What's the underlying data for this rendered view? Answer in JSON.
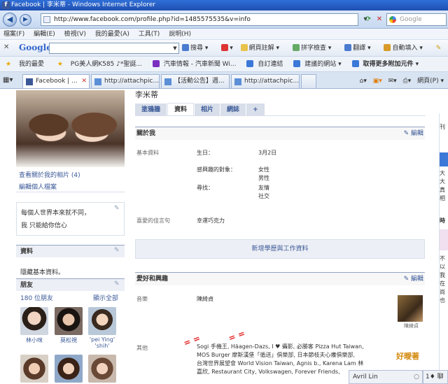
{
  "window": {
    "title": "Facebook | 李米蒂 - Windows Internet Explorer"
  },
  "address_bar": {
    "url": "http://www.facebook.com/profile.php?id=1485575535&v=info",
    "search_placeholder": "Google"
  },
  "menu": [
    "檔案(F)",
    "編輯(E)",
    "檢視(V)",
    "我的最愛(A)",
    "工具(T)",
    "說明(H)"
  ],
  "google_toolbar": {
    "logo": "Google",
    "items": [
      "搜尋 ▾",
      "",
      "網頁註解 ▾",
      "拼字檢查 ▾",
      "翻譯 ▾",
      "自動填入 ▾"
    ]
  },
  "favorites_bar": {
    "label": "我的最愛",
    "items": [
      "PG美人網K585 ♪*聖誕...",
      "汽車情報 - 汽車新聞 Wi...",
      "自訂連結",
      "建議的網站 ▾",
      "取得更多附加元件 ▾"
    ]
  },
  "tabs": [
    {
      "label": "Facebook | ..."
    },
    {
      "label": "http://attachpic..."
    },
    {
      "label": "【活動公告】週..."
    },
    {
      "label": "http://attachpic..."
    }
  ],
  "tab_tools": [
    "網頁(P) ▾"
  ],
  "profile": {
    "name": "李米蒂",
    "tabs": [
      "塗鴉牆",
      "資料",
      "相片",
      "網誌",
      "+"
    ],
    "view_photos": "查看關於我的相片 (4)",
    "edit_profile": "編輯個人檔案",
    "status_lines": [
      "每個人世界本來就不同，",
      "我 只能給你信心"
    ],
    "info_box_title": "資料",
    "info_box_text": "隱藏基本資料。",
    "friends_title": "朋友",
    "friends_count": "180 位朋友",
    "friends_show_all": "顯示全部",
    "friends": [
      {
        "name": "林小咪"
      },
      {
        "name": "莫松視"
      },
      {
        "name": "'pei Ying' 'shih'"
      }
    ]
  },
  "about": {
    "title": "關於我",
    "edit": "編輯",
    "basic_info_label": "基本資料",
    "birthday_label": "生日：",
    "birthday_value": "3月2日",
    "interested_in_label": "感興趣的對象：",
    "interested_in_values": [
      "女性",
      "男性"
    ],
    "looking_for_label": "尋找：",
    "looking_for_values": [
      "友情",
      "社交"
    ],
    "quote_label": "喜愛的佳言句",
    "quote_value": "幸運巧克力",
    "add_education": "新增學歷與工作資料"
  },
  "likes": {
    "title": "愛好和興趣",
    "edit": "編輯",
    "music_label": "音樂",
    "music_value": "陳綺貞",
    "music_thumb_caption": "陳綺貞",
    "other_label": "其他",
    "other_lines": [
      "Sogi 手機王, Häagen-Dazs, I ♥ 攝影, 必勝客  Pizza Hut Taiwan,",
      "MOS Burger 摩斯漢堡「循送」俱樂部, 日本節枝夫心癢俱樂部,",
      "台灣世界展望會  World Vision Taiwan, Agnis b., Karena Lam 林",
      "嘉欣, Restaurant City, Volkswagen, Forever Friends,"
    ],
    "logo_text": "好曖著"
  },
  "right_strip": [
    "刊",
    "大",
    "大",
    "真",
    "相",
    "時",
    "不",
    "以",
    "我",
    "在",
    "尚",
    "也"
  ],
  "chat": {
    "user": "Avril Lin",
    "chat_label": "聊天"
  },
  "handwritten_mark": "= ="
}
